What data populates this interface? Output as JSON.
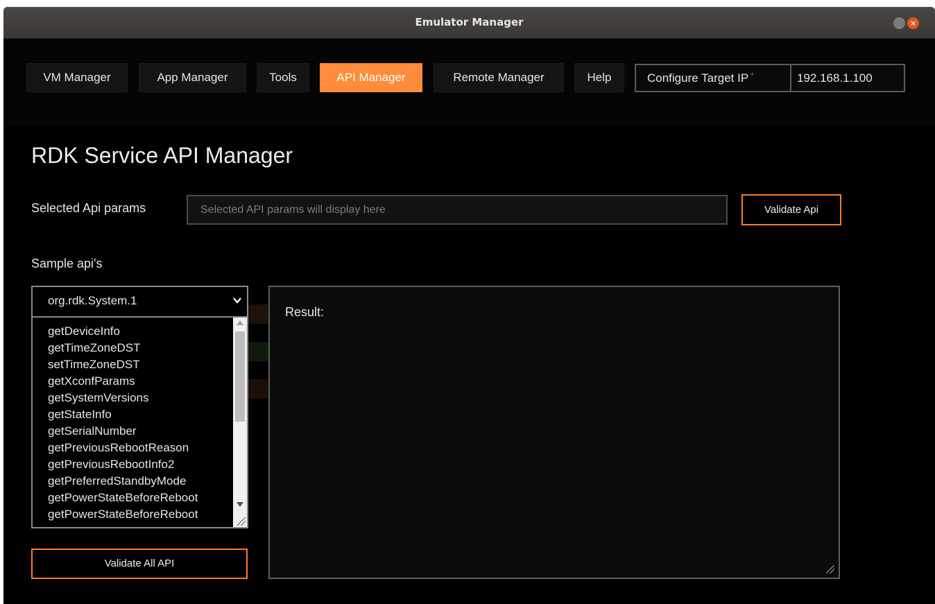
{
  "window": {
    "title": "Emulator Manager",
    "close_glyph": "×"
  },
  "nav": {
    "items": [
      {
        "label": "VM Manager"
      },
      {
        "label": "App Manager"
      },
      {
        "label": "Tools"
      },
      {
        "label": "API Manager",
        "active": true
      },
      {
        "label": "Remote Manager"
      },
      {
        "label": "Help"
      }
    ],
    "target_ip": {
      "label": "Configure Target IP",
      "required_mark": "*",
      "value": "192.168.1.100"
    }
  },
  "page": {
    "title": "RDK Service API Manager",
    "params_label": "Selected Api params",
    "params_placeholder": "Selected API params will display here",
    "validate_api_label": "Validate Api",
    "sample_label": "Sample api's",
    "selected_service": "org.rdk.System.1",
    "api_list": [
      "getDeviceInfo",
      "getTimeZoneDST",
      "setTimeZoneDST",
      "getXconfParams",
      "getSystemVersions",
      "getStateInfo",
      "getSerialNumber",
      "getPreviousRebootReason",
      "getPreviousRebootInfo2",
      "getPreferredStandbyMode",
      "getPowerStateBeforeReboot",
      "getPowerStateBeforeReboot"
    ],
    "result_label": "Result:",
    "validate_all_label": "Validate All API"
  },
  "colors": {
    "accent": "#ff8c3a",
    "accent_border": "#ff7a2a",
    "background": "#000000"
  }
}
